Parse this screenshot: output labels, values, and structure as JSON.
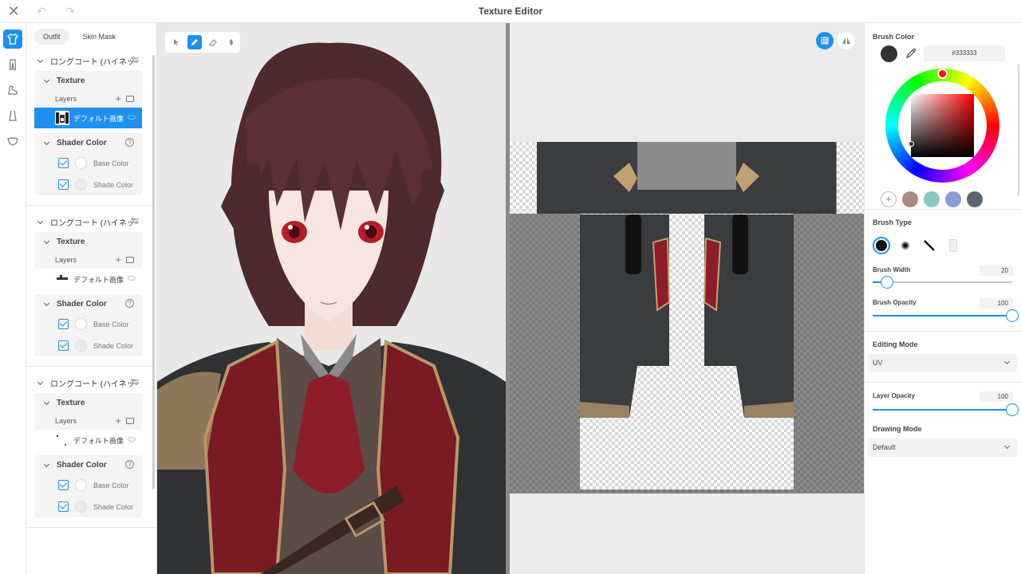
{
  "window": {
    "title": "Texture Editor"
  },
  "left_tabs": [
    "Outfit",
    "Skin Mask"
  ],
  "sections": [
    {
      "name": "ロングコート (ハイネッ",
      "texture_label": "Texture",
      "layers_label": "Layers",
      "layer_name": "デフォルト画像",
      "selected": true,
      "shader_label": "Shader Color",
      "base_label": "Base Color",
      "shade_label": "Shade Color"
    },
    {
      "name": "ロングコート (ハイネッ",
      "texture_label": "Texture",
      "layers_label": "Layers",
      "layer_name": "デフォルト画像",
      "selected": false,
      "shader_label": "Shader Color",
      "base_label": "Base Color",
      "shade_label": "Shade Color"
    },
    {
      "name": "ロングコート (ハイネッ",
      "texture_label": "Texture",
      "layers_label": "Layers",
      "layer_name": "デフォルト画像",
      "selected": false,
      "shader_label": "Shader Color",
      "base_label": "Base Color",
      "shade_label": "Shade Color"
    }
  ],
  "brush_color": {
    "label": "Brush Color",
    "hex": "#333333",
    "presets": [
      "#a98a80",
      "#88c8be",
      "#8d9bd4",
      "#5e6470"
    ]
  },
  "brush_type": {
    "label": "Brush Type"
  },
  "brush_width": {
    "label": "Brush Width",
    "value": "20",
    "fraction": 0.1
  },
  "brush_opacity": {
    "label": "Brush Opacity",
    "value": "100",
    "fraction": 1.0
  },
  "editing_mode": {
    "label": "Editing Mode",
    "value": "UV"
  },
  "layer_opacity": {
    "label": "Layer Opacity",
    "value": "100",
    "fraction": 1.0
  },
  "drawing_mode": {
    "label": "Drawing Mode",
    "value": "Default"
  },
  "colors": {
    "accent": "#1e90ef"
  }
}
